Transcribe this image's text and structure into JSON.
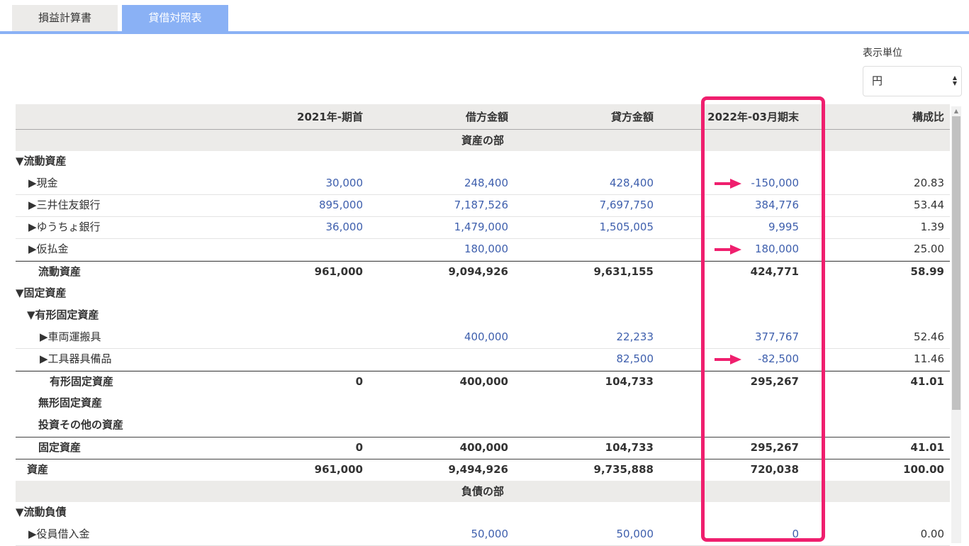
{
  "tabs": [
    {
      "label": "損益計算書",
      "active": false
    },
    {
      "label": "貸借対照表",
      "active": true
    }
  ],
  "unit": {
    "label": "表示単位",
    "selected": "円"
  },
  "colors": {
    "accent_tab": "#8ab1f5",
    "link_blue": "#3e5fad",
    "highlight": "#ef1f6e"
  },
  "table": {
    "headers": [
      "",
      "2021年-期首",
      "借方金額",
      "貸方金額",
      "2022年-03月期末",
      "構成比"
    ],
    "rows": [
      {
        "type": "section",
        "label": "資産の部"
      },
      {
        "type": "group",
        "label": "▼流動資産"
      },
      {
        "type": "item",
        "label": "▶現金",
        "values": [
          "30,000",
          "248,400",
          "428,400",
          "-150,000",
          "20.83"
        ],
        "arrow": true
      },
      {
        "type": "item",
        "label": "▶三井住友銀行",
        "values": [
          "895,000",
          "7,187,526",
          "7,697,750",
          "384,776",
          "53.44"
        ]
      },
      {
        "type": "item",
        "label": "▶ゆうちょ銀行",
        "values": [
          "36,000",
          "1,479,000",
          "1,505,005",
          "9,995",
          "1.39"
        ]
      },
      {
        "type": "item",
        "label": "▶仮払金",
        "values": [
          "",
          "180,000",
          "",
          "180,000",
          "25.00"
        ],
        "arrow": true
      },
      {
        "type": "total",
        "label": "流動資産",
        "values": [
          "961,000",
          "9,094,926",
          "9,631,155",
          "424,771",
          "58.99"
        ]
      },
      {
        "type": "group",
        "label": "▼固定資産"
      },
      {
        "type": "group2",
        "label": "▼有形固定資産"
      },
      {
        "type": "item2",
        "label": "▶車両運搬具",
        "values": [
          "",
          "400,000",
          "22,233",
          "377,767",
          "52.46"
        ]
      },
      {
        "type": "item2",
        "label": "▶工具器具備品",
        "values": [
          "",
          "",
          "82,500",
          "-82,500",
          "11.46"
        ],
        "arrow": true
      },
      {
        "type": "total2",
        "label": "有形固定資産",
        "values": [
          "0",
          "400,000",
          "104,733",
          "295,267",
          "41.01"
        ]
      },
      {
        "type": "sublabel",
        "label": "無形固定資産"
      },
      {
        "type": "sublabel",
        "label": "投資その他の資産"
      },
      {
        "type": "total",
        "label": "固定資産",
        "values": [
          "0",
          "400,000",
          "104,733",
          "295,267",
          "41.01"
        ]
      },
      {
        "type": "grand",
        "label": "資産",
        "values": [
          "961,000",
          "9,494,926",
          "9,735,888",
          "720,038",
          "100.00"
        ]
      },
      {
        "type": "section",
        "label": "負債の部"
      },
      {
        "type": "group",
        "label": "▼流動負債"
      },
      {
        "type": "item",
        "label": "▶役員借入金",
        "values": [
          "",
          "50,000",
          "50,000",
          "0",
          "0.00"
        ]
      }
    ]
  }
}
